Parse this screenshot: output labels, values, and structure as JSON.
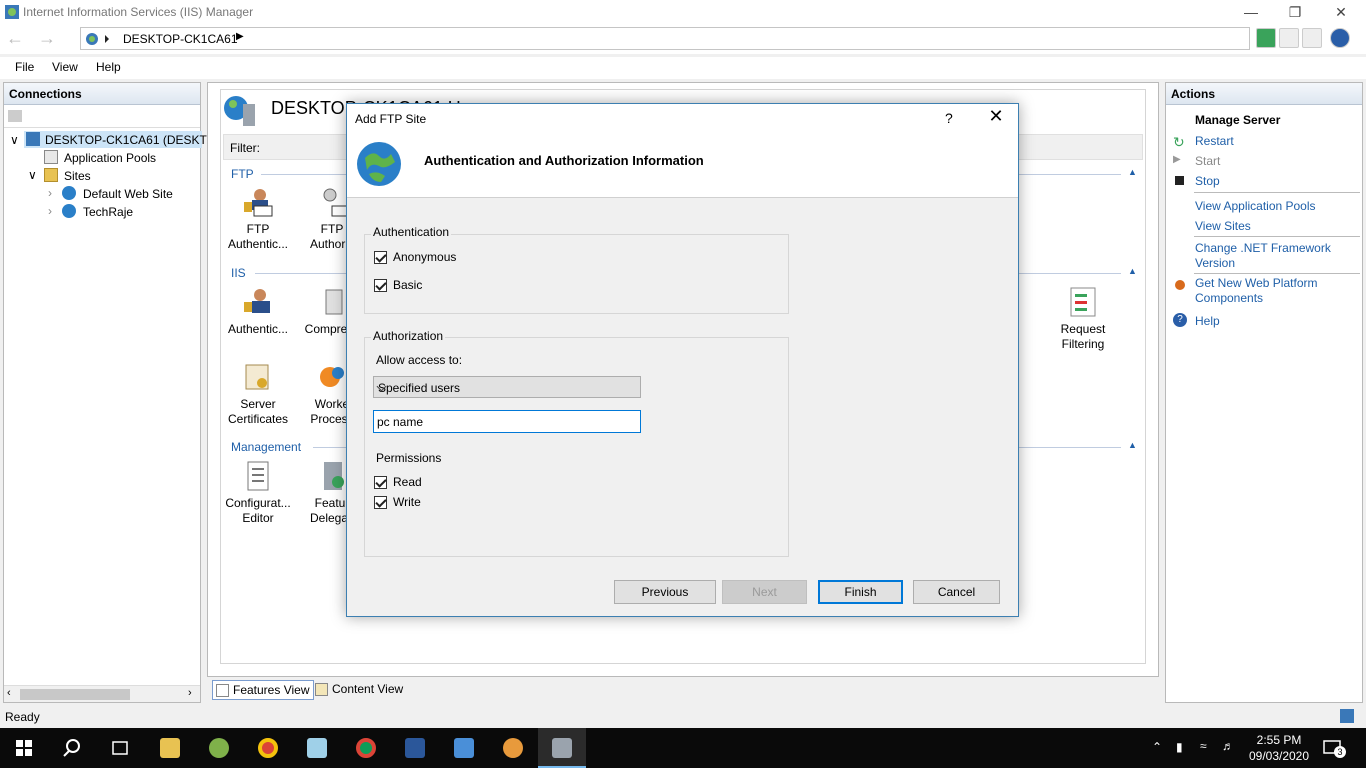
{
  "window": {
    "title": "Internet Information Services (IIS) Manager"
  },
  "address": {
    "crumb": "DESKTOP-CK1CA61"
  },
  "menu": {
    "file": "File",
    "view": "View",
    "help": "Help"
  },
  "connections": {
    "header": "Connections",
    "tree": {
      "server": "DESKTOP-CK1CA61 (DESKTOP",
      "app_pools": "Application Pools",
      "sites": "Sites",
      "site1": "Default Web Site",
      "site2": "TechRaje"
    }
  },
  "center": {
    "title": "DESKTOP-CK1CA61 H",
    "filter_label": "Filter:",
    "groups": {
      "ftp": "FTP",
      "iis": "IIS",
      "management": "Management"
    },
    "features": {
      "ftp_auth_1": "FTP",
      "ftp_auth_2": "Authentic...",
      "ftp_authz_1": "FTP",
      "ftp_authz_2": "Authoriz",
      "user_iso_1": "ser",
      "user_iso_2": "on",
      "authentication": "Authentic...",
      "compression": "Compress",
      "output_1": "ut",
      "output_2": "ng",
      "request_filtering_1": "Request",
      "request_filtering_2": "Filtering",
      "server_certs_1": "Server",
      "server_certs_2": "Certificates",
      "worker_1": "Worke",
      "worker_2": "Process",
      "config_editor_1": "Configurat...",
      "config_editor_2": "Editor",
      "feature_deleg_1": "Featur",
      "feature_deleg_2": "Delegati"
    }
  },
  "view_tabs": {
    "features": "Features View",
    "content": "Content View"
  },
  "actions": {
    "header": "Actions",
    "manage_server": "Manage Server",
    "restart": "Restart",
    "start": "Start",
    "stop": "Stop",
    "view_app_pools": "View Application Pools",
    "view_sites": "View Sites",
    "change_net": "Change .NET Framework Version",
    "get_web_platform": "Get New Web Platform Components",
    "help": "Help"
  },
  "status": {
    "text": "Ready"
  },
  "dialog": {
    "title": "Add FTP Site",
    "help": "?",
    "heading": "Authentication and Authorization Information",
    "authentication": {
      "legend": "Authentication",
      "anonymous": "Anonymous",
      "basic": "Basic"
    },
    "authorization": {
      "legend": "Authorization",
      "allow_access_label": "Allow access to:",
      "allow_access_value": "Specified users",
      "users_value": "pc name"
    },
    "permissions": {
      "label": "Permissions",
      "read": "Read",
      "write": "Write"
    },
    "buttons": {
      "previous": "Previous",
      "next": "Next",
      "finish": "Finish",
      "cancel": "Cancel"
    }
  },
  "taskbar": {
    "time": "2:55 PM",
    "date": "09/03/2020",
    "notifications": "3"
  },
  "colors": {
    "accent": "#0078d7",
    "link": "#1f5fa8",
    "taskbar": "#0a0a0a"
  }
}
